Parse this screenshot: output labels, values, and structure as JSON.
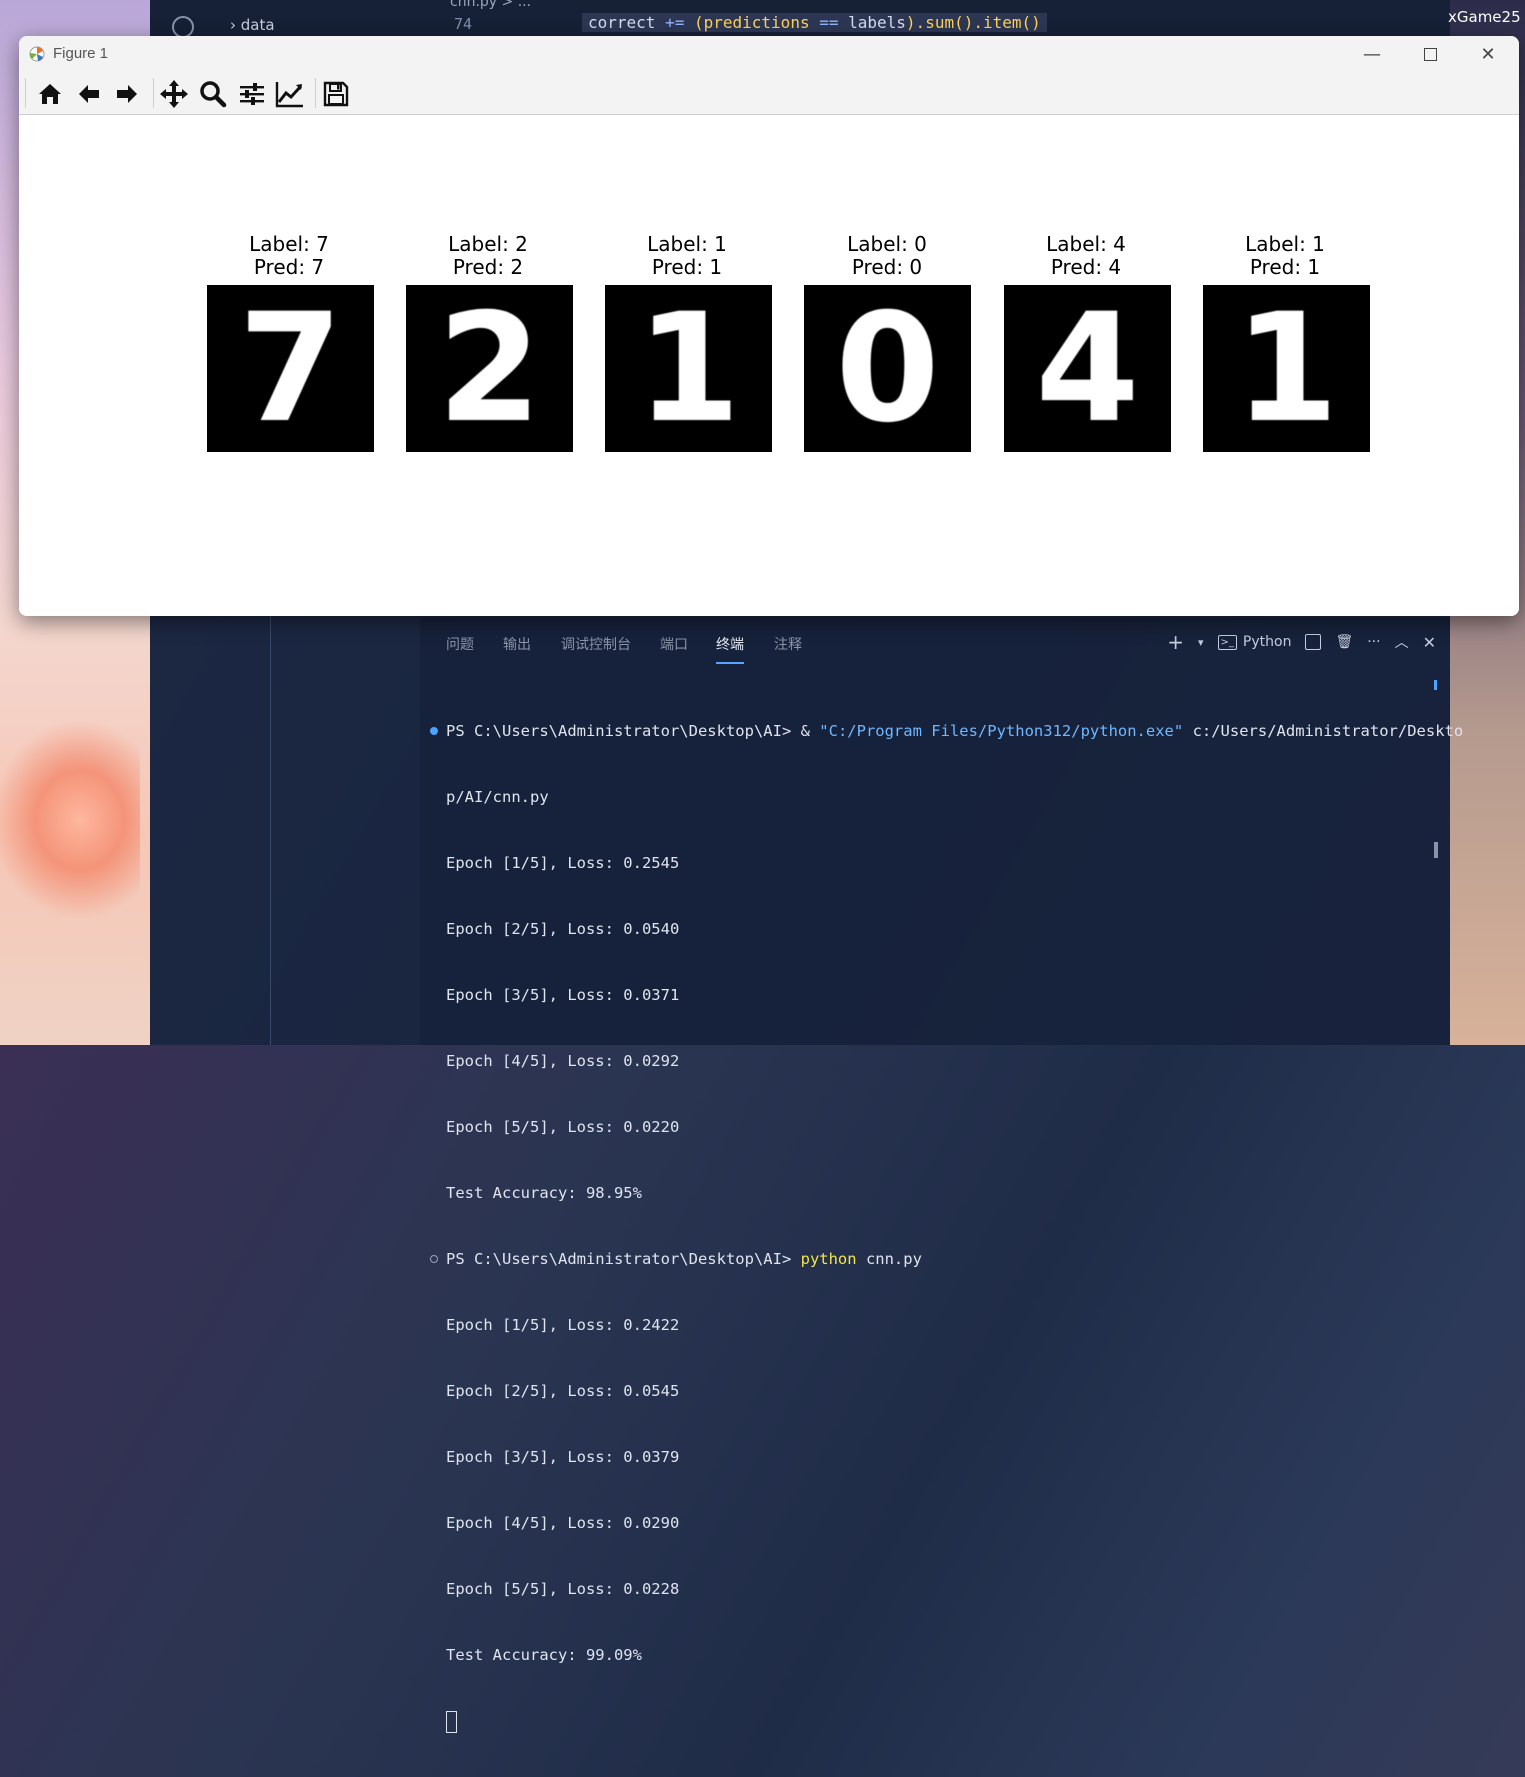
{
  "background_editor": {
    "explorer_item": "data",
    "tab_crumb": "cnn.py > ...",
    "line_number": "74",
    "code": {
      "var": "correct",
      "op": "+=",
      "expr_left": "(predictions",
      "eq": "==",
      "expr_right": "labels",
      "tail": ").sum().item()"
    },
    "corner_user": "xGame25"
  },
  "figure_window": {
    "title": "Figure 1",
    "toolbar": {
      "home": "home-icon",
      "back": "back-arrow-icon",
      "forward": "forward-arrow-icon",
      "pan": "pan-move-icon",
      "zoom": "zoom-magnifier-icon",
      "configure": "subplots-config-icon",
      "edit": "edit-axis-line-icon",
      "save": "save-floppy-icon"
    },
    "panels": [
      {
        "label_line": "Label: 7",
        "pred_line": "Pred: 7",
        "digit": "7"
      },
      {
        "label_line": "Label: 2",
        "pred_line": "Pred: 2",
        "digit": "2"
      },
      {
        "label_line": "Label: 1",
        "pred_line": "Pred: 1",
        "digit": "1"
      },
      {
        "label_line": "Label: 0",
        "pred_line": "Pred: 0",
        "digit": "0"
      },
      {
        "label_line": "Label: 4",
        "pred_line": "Pred: 4",
        "digit": "4"
      },
      {
        "label_line": "Label: 1",
        "pred_line": "Pred: 1",
        "digit": "1"
      }
    ]
  },
  "terminal_panel": {
    "tabs": [
      "问题",
      "输出",
      "调试控制台",
      "端口",
      "终端",
      "注释"
    ],
    "active_tab": "终端",
    "shell_label": "Python",
    "lines": {
      "l1_prompt": "PS C:\\Users\\Administrator\\Desktop\\AI> & ",
      "l1_str": "\"C:/Program Files/Python312/python.exe\"",
      "l1_rest": " c:/Users/Administrator/Deskto",
      "l2": "p/AI/cnn.py",
      "run1": [
        "Epoch [1/5], Loss: 0.2545",
        "Epoch [2/5], Loss: 0.0540",
        "Epoch [3/5], Loss: 0.0371",
        "Epoch [4/5], Loss: 0.0292",
        "Epoch [5/5], Loss: 0.0220",
        "Test Accuracy: 98.95%"
      ],
      "p2_prompt": "PS C:\\Users\\Administrator\\Desktop\\AI> ",
      "p2_cmd": "python",
      "p2_rest": " cnn.py",
      "run2": [
        "Epoch [1/5], Loss: 0.2422",
        "Epoch [2/5], Loss: 0.0545",
        "Epoch [3/5], Loss: 0.0379",
        "Epoch [4/5], Loss: 0.0290",
        "Epoch [5/5], Loss: 0.0228",
        "Test Accuracy: 99.09%"
      ]
    }
  }
}
